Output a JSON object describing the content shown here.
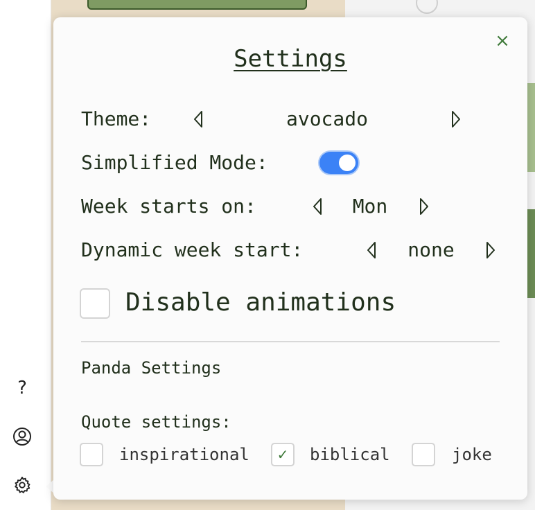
{
  "sidebar": {
    "icons": [
      "question-icon",
      "user-circle-icon",
      "gear-icon"
    ],
    "help_glyph": "?"
  },
  "modal": {
    "title": "Settings",
    "close_glyph": "×",
    "theme": {
      "label": "Theme:",
      "value": "avocado"
    },
    "simplified_mode": {
      "label": "Simplified Mode:",
      "enabled": true
    },
    "week_start": {
      "label": "Week starts on:",
      "value": "Mon"
    },
    "dynamic_week_start": {
      "label": "Dynamic week start:",
      "value": "none"
    },
    "disable_animations": {
      "label": "Disable animations",
      "checked": false
    },
    "panda_section_title": "Panda Settings",
    "quote_settings": {
      "label": "Quote settings:",
      "options": [
        {
          "label": "inspirational",
          "checked": false
        },
        {
          "label": "biblical",
          "checked": true
        },
        {
          "label": "joke",
          "checked": false
        }
      ]
    }
  },
  "colors": {
    "accent_green": "#3f7a3a",
    "toggle_blue": "#3b82f6",
    "text_dark_green": "#21301c",
    "background_tan": "#e9dcc6"
  }
}
